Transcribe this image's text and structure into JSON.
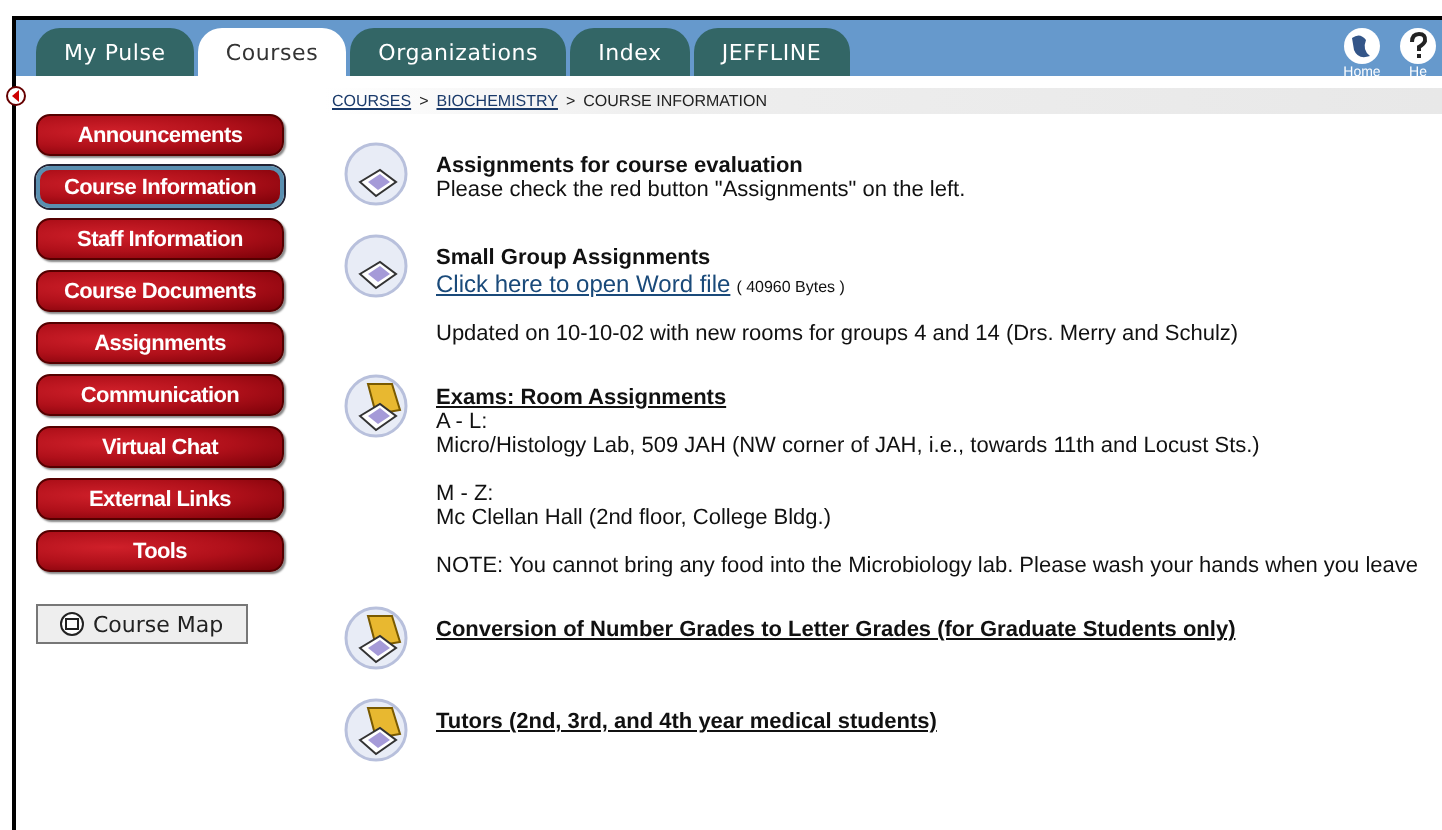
{
  "tabs": [
    {
      "label": "My Pulse",
      "selected": false
    },
    {
      "label": "Courses",
      "selected": true
    },
    {
      "label": "Organizations",
      "selected": false
    },
    {
      "label": "Index",
      "selected": false
    },
    {
      "label": "JEFFLINE",
      "selected": false
    }
  ],
  "top_icons": [
    {
      "label": "Home",
      "kind": "globe"
    },
    {
      "label": "He",
      "kind": "help"
    }
  ],
  "nav_buttons": [
    {
      "label": "Announcements",
      "selected": false
    },
    {
      "label": "Course Information",
      "selected": true
    },
    {
      "label": "Staff Information",
      "selected": false
    },
    {
      "label": "Course Documents",
      "selected": false
    },
    {
      "label": "Assignments",
      "selected": false
    },
    {
      "label": "Communication",
      "selected": false
    },
    {
      "label": "Virtual Chat",
      "selected": false
    },
    {
      "label": "External Links",
      "selected": false
    },
    {
      "label": "Tools",
      "selected": false
    }
  ],
  "course_map": {
    "label": "Course Map"
  },
  "breadcrumb": [
    {
      "label": "COURSES",
      "link": true
    },
    {
      "separator": ">",
      "label": "BIOCHEMISTRY",
      "link": true
    },
    {
      "separator": ">",
      "label": "COURSE INFORMATION",
      "link": false
    }
  ],
  "items": [
    {
      "kind": "document",
      "title": "Assignments for course evaluation",
      "title_link": false,
      "paragraphs": [
        {
          "kind": "text",
          "lines": [
            "Please check the red button \"Assignments\" on the left."
          ]
        }
      ]
    },
    {
      "kind": "document",
      "title": "Small Group Assignments",
      "title_link": false,
      "paragraphs": [
        {
          "kind": "file",
          "link": "Click here to open Word file",
          "size": "( 40960 Bytes )"
        },
        {
          "kind": "text",
          "lines": [
            "Updated on 10-10-02 with new rooms for groups 4 and 14 (Drs. Merry and Schulz)"
          ]
        }
      ]
    },
    {
      "kind": "folder",
      "title": "Exams: Room Assignments",
      "title_link": true,
      "paragraphs": [
        {
          "kind": "text",
          "lines": [
            "A - L:",
            "Micro/Histology Lab, 509 JAH (NW corner of JAH, i.e., towards 11th and Locust Sts.)"
          ]
        },
        {
          "kind": "text",
          "lines": [
            "M - Z:",
            "Mc Clellan Hall (2nd floor, College Bldg.)"
          ]
        },
        {
          "kind": "text",
          "lines": [
            "NOTE: You cannot bring any food into the Microbiology lab. Please wash your hands when you leave"
          ]
        }
      ]
    },
    {
      "kind": "folder",
      "title": "Conversion of Number Grades to Letter Grades (for Graduate Students only)",
      "title_link": true
    },
    {
      "kind": "folder",
      "title": "Tutors (2nd, 3rd, and 4th year medical students)",
      "title_link": true
    }
  ]
}
